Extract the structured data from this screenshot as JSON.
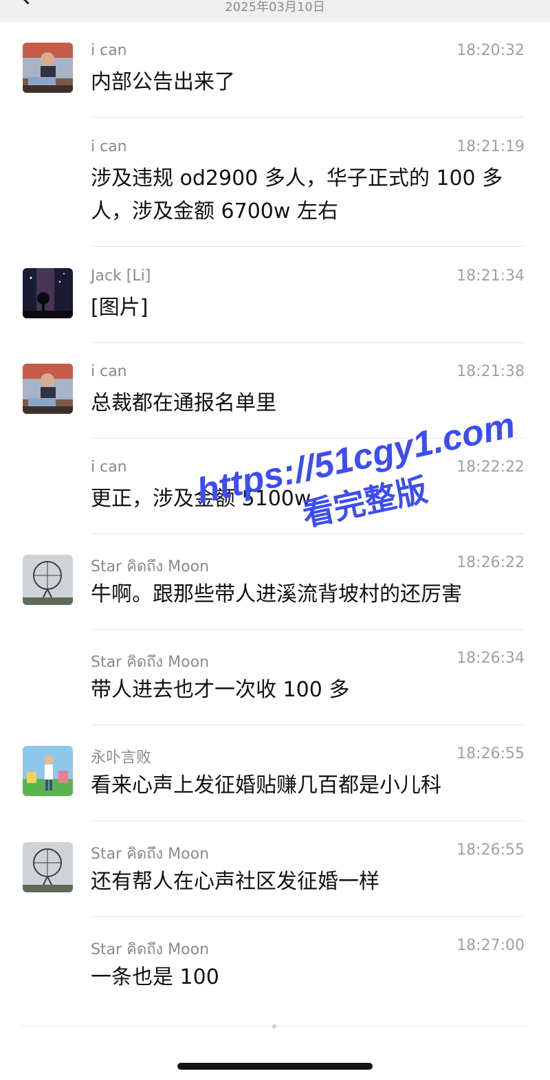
{
  "header": {
    "date": "2025年03月10日",
    "back_icon": "chevron-left-icon"
  },
  "messages": [
    {
      "sender": "i can",
      "time": "18:20:32",
      "text": "内部公告出来了",
      "avatar": "i-can"
    },
    {
      "sender": "i can",
      "time": "18:21:19",
      "text": "涉及违规 od2900 多人，华子正式的 100 多人，涉及金额 6700w 左右",
      "avatar": ""
    },
    {
      "sender": "Jack [Li]",
      "time": "18:21:34",
      "text": "[图片]",
      "avatar": "jack"
    },
    {
      "sender": "i can",
      "time": "18:21:38",
      "text": "总裁都在通报名单里",
      "avatar": "i-can"
    },
    {
      "sender": "i can",
      "time": "18:22:22",
      "text": "更正，涉及金额 5100w",
      "avatar": ""
    },
    {
      "sender": "Star คิดถึง Moon",
      "time": "18:26:22",
      "text": "牛啊。跟那些带人进溪流背坡村的还厉害",
      "avatar": "star"
    },
    {
      "sender": "Star คิดถึง Moon",
      "time": "18:26:34",
      "text": "带人进去也才一次收 100 多",
      "avatar": ""
    },
    {
      "sender": "永卟言败",
      "time": "18:26:55",
      "text": "看来心声上发征婚贴赚几百都是小儿科",
      "avatar": "yong"
    },
    {
      "sender": "Star คิดถึง Moon",
      "time": "18:26:55",
      "text": "还有帮人在心声社区发征婚一样",
      "avatar": "star"
    },
    {
      "sender": "Star คิดถึง Moon",
      "time": "18:27:00",
      "text": "一条也是 100",
      "avatar": ""
    }
  ],
  "watermark": {
    "url": "https://51cgy1.com",
    "caption": "看完整版",
    "color": "#3d4df2"
  },
  "colors": {
    "sender": "#8a8a8a",
    "time": "#a0a0a0",
    "text": "#111111",
    "divider": "#e6e6e6"
  }
}
